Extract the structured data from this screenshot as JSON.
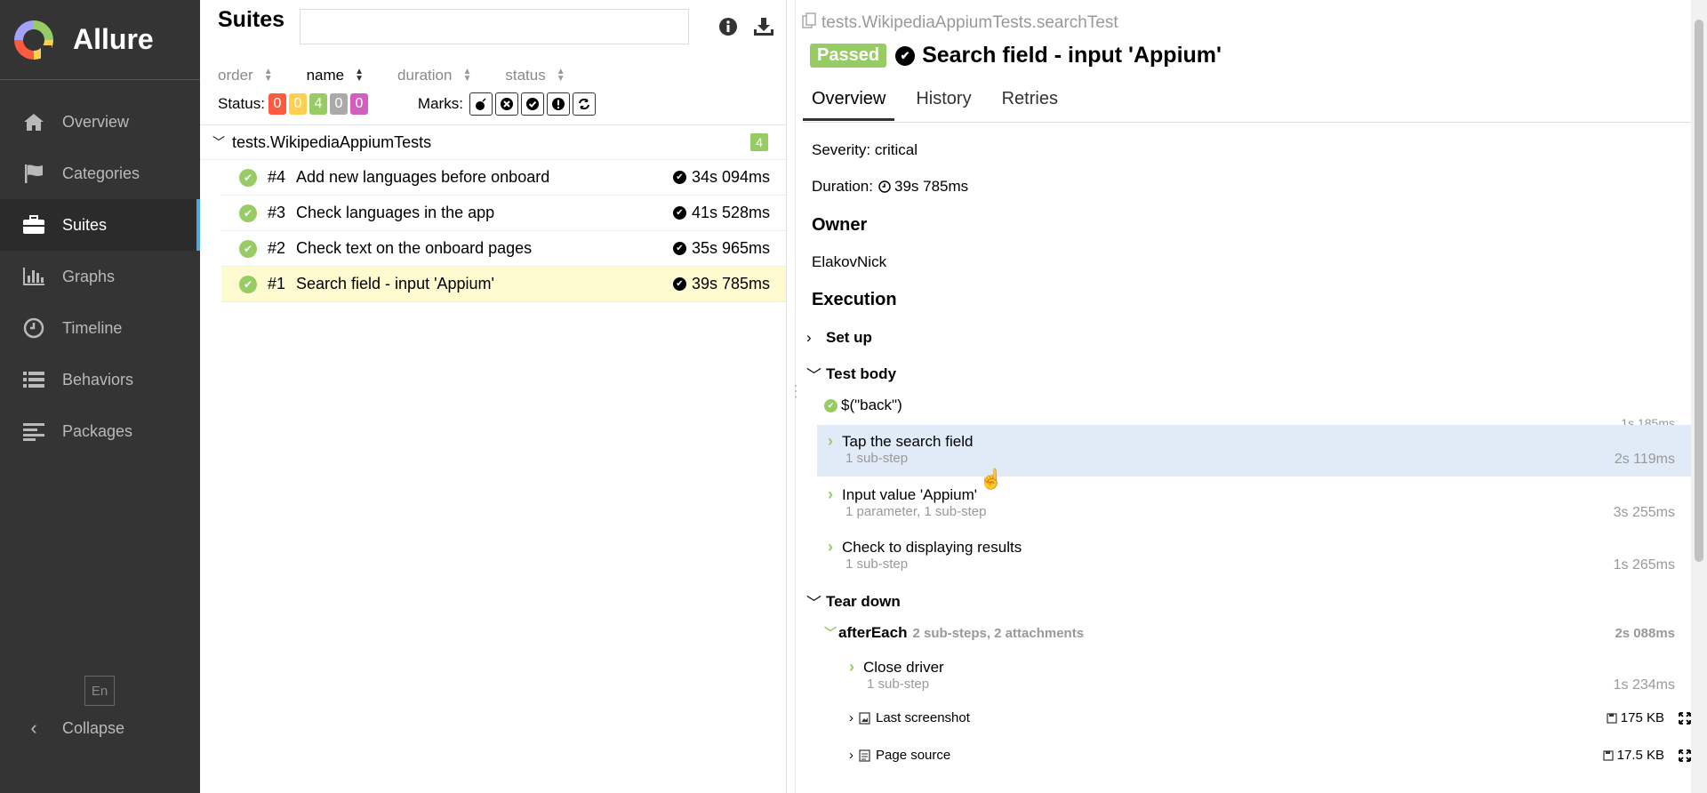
{
  "sidebar": {
    "brand": "Allure",
    "items": [
      {
        "label": "Overview",
        "icon": "home-icon"
      },
      {
        "label": "Categories",
        "icon": "flag-icon"
      },
      {
        "label": "Suites",
        "icon": "briefcase-icon"
      },
      {
        "label": "Graphs",
        "icon": "bar-chart-icon"
      },
      {
        "label": "Timeline",
        "icon": "clock-icon"
      },
      {
        "label": "Behaviors",
        "icon": "list-icon"
      },
      {
        "label": "Packages",
        "icon": "align-left-icon"
      }
    ],
    "active": "Suites",
    "language": "En",
    "collapse": "Collapse"
  },
  "suites": {
    "title": "Suites",
    "search_placeholder": "",
    "sort": {
      "order": "order",
      "name": "name",
      "duration": "duration",
      "status": "status"
    },
    "status_label": "Status:",
    "status_counts": [
      {
        "value": "0",
        "color": "#fd5a3e"
      },
      {
        "value": "0",
        "color": "#ffd050"
      },
      {
        "value": "4",
        "color": "#97cc64"
      },
      {
        "value": "0",
        "color": "#aaaaaa"
      },
      {
        "value": "0",
        "color": "#d35ebe"
      }
    ],
    "marks_label": "Marks:",
    "group": {
      "name": "tests.WikipediaAppiumTests",
      "count": "4"
    },
    "tests": [
      {
        "num": "#4",
        "name": "Add new languages before onboard",
        "duration": "34s 094ms"
      },
      {
        "num": "#3",
        "name": "Check languages in the app",
        "duration": "41s 528ms"
      },
      {
        "num": "#2",
        "name": "Check text on the onboard pages",
        "duration": "35s 965ms"
      },
      {
        "num": "#1",
        "name": "Search field - input 'Appium'",
        "duration": "39s 785ms"
      }
    ]
  },
  "detail": {
    "path": "tests.WikipediaAppiumTests.searchTest",
    "status": "Passed",
    "title": "Search field - input 'Appium'",
    "tabs": [
      "Overview",
      "History",
      "Retries"
    ],
    "severity": "Severity: critical",
    "duration_label": "Duration:",
    "duration": "39s 785ms",
    "owner_heading": "Owner",
    "owner": "ElakovNick",
    "execution_heading": "Execution",
    "setup": "Set up",
    "test_body": "Test body",
    "back_step": "$(\"back\")",
    "back_partial_duration": "1s 185ms",
    "steps": [
      {
        "name": "Tap the search field",
        "sub": "1 sub-step",
        "duration": "2s 119ms"
      },
      {
        "name": "Input value 'Appium'",
        "sub": "1 parameter, 1 sub-step",
        "duration": "3s 255ms"
      },
      {
        "name": "Check to displaying results",
        "sub": "1 sub-step",
        "duration": "1s 265ms"
      }
    ],
    "teardown": "Tear down",
    "after_each": {
      "name": "afterEach",
      "meta": "2 sub-steps, 2 attachments",
      "duration": "2s 088ms"
    },
    "close_driver": {
      "name": "Close driver",
      "sub": "1 sub-step",
      "duration": "1s 234ms"
    },
    "attachments": [
      {
        "name": "Last screenshot",
        "size": "175 KB"
      },
      {
        "name": "Page source",
        "size": "17.5 KB"
      }
    ]
  }
}
